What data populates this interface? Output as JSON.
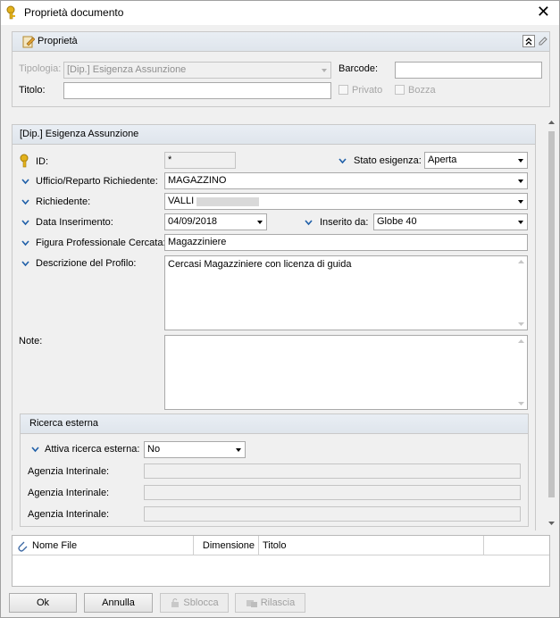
{
  "window": {
    "title": "Proprietà documento",
    "close_glyph": "✕"
  },
  "properties": {
    "header": "Proprietà",
    "tipologia_label": "Tipologia:",
    "tipologia_value": "[Dip.] Esigenza Assunzione",
    "titolo_label": "Titolo:",
    "titolo_value": "",
    "barcode_label": "Barcode:",
    "barcode_value": "",
    "privato_label": "Privato",
    "bozza_label": "Bozza"
  },
  "form": {
    "header": "[Dip.] Esigenza Assunzione",
    "id_label": "ID:",
    "id_value": "*",
    "stato_label": "Stato esigenza:",
    "stato_value": "Aperta",
    "ufficio_label": "Ufficio/Reparto Richiedente:",
    "ufficio_value": "MAGAZZINO",
    "richiedente_label": "Richiedente:",
    "richiedente_value": "VALLI",
    "data_label": "Data Inserimento:",
    "data_value": "04/09/2018",
    "inserito_label": "Inserito da:",
    "inserito_value": "Globe 40",
    "figura_label": "Figura Professionale Cercata:",
    "figura_value": "Magazziniere",
    "descrizione_label": "Descrizione del Profilo:",
    "descrizione_value": "Cercasi Magazziniere con licenza di guida",
    "note_label": "Note:",
    "note_value": "",
    "ricerca": {
      "header": "Ricerca esterna",
      "attiva_label": "Attiva ricerca esterna:",
      "attiva_value": "No",
      "agenzia_label_1": "Agenzia Interinale:",
      "agenzia_label_2": "Agenzia Interinale:",
      "agenzia_label_3": "Agenzia Interinale:"
    }
  },
  "files": {
    "columns": [
      "Nome File",
      "Dimensione",
      "Titolo"
    ]
  },
  "buttons": {
    "ok": "Ok",
    "annulla": "Annulla",
    "sblocca": "Sblocca",
    "rilascia": "Rilascia"
  },
  "colors": {
    "chevron": "#1f5fa8",
    "key_icon": "#e3b21c"
  }
}
